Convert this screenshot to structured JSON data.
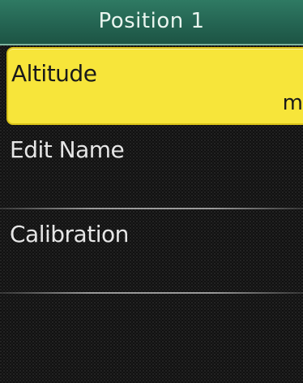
{
  "header": {
    "title": "Position 1"
  },
  "menu": {
    "items": [
      {
        "label": "Altitude",
        "value": "m",
        "selected": true
      },
      {
        "label": "Edit Name"
      },
      {
        "label": "Calibration"
      }
    ]
  },
  "colors": {
    "header_bg": "#246452",
    "selected_bg": "#f7e53a",
    "screen_bg": "#111111",
    "text_light": "#e6e6e6",
    "text_dark": "#1a1a1a"
  }
}
